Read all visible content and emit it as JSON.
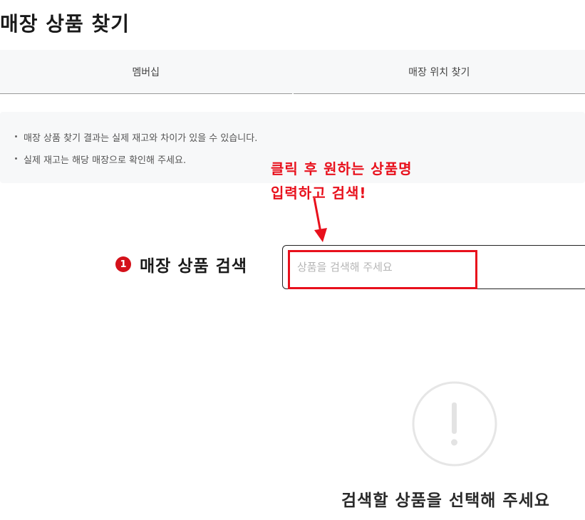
{
  "page": {
    "title": "매장 상품 찾기"
  },
  "tabs": [
    {
      "label": "멤버십"
    },
    {
      "label": "매장 위치 찾기"
    }
  ],
  "notice": {
    "items": [
      "매장 상품 찾기 결과는 실제 재고와 차이가 있을 수 있습니다.",
      "실제 재고는 해당 매장으로 확인해 주세요."
    ]
  },
  "annotation": {
    "line1": "클릭 후 원하는 상품명",
    "line2": "입력하고 검색!",
    "color": "#e8101c"
  },
  "search": {
    "step_number": "1",
    "label": "매장 상품 검색",
    "placeholder": "상품을 검색해 주세요",
    "value": ""
  },
  "empty_state": {
    "icon": "exclamation-circle-icon",
    "message": "검색할 상품을 선택해 주세요"
  },
  "colors": {
    "accent_red": "#d4111a",
    "notice_bg": "#f7f8f9"
  }
}
